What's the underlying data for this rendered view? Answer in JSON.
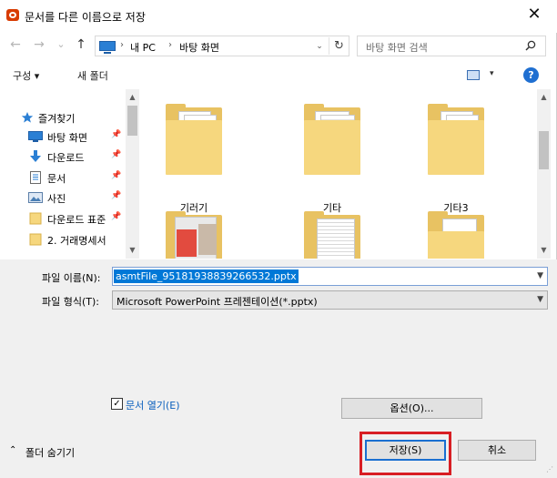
{
  "window": {
    "title": "문서를 다른 이름으로 저장",
    "close": "✕"
  },
  "nav": {
    "back": "←",
    "forward": "→",
    "recent": "⌄",
    "up": "↑",
    "breadcrumb": [
      "내 PC",
      "바탕 화면"
    ],
    "separator": "›",
    "dropdown": "⌄",
    "refresh": "↻",
    "search_placeholder": "바탕 화면 검색"
  },
  "toolbar": {
    "organize": "구성 ▾",
    "new_folder": "새 폴더",
    "view_dd": "▾",
    "help": "?"
  },
  "sidebar": {
    "items": [
      {
        "label": "즐겨찾기",
        "icon": "star-icon",
        "pinned": false
      },
      {
        "label": "바탕 화면",
        "icon": "desktop-icon",
        "pinned": true
      },
      {
        "label": "다운로드",
        "icon": "download-icon",
        "pinned": true
      },
      {
        "label": "문서",
        "icon": "document-icon",
        "pinned": true
      },
      {
        "label": "사진",
        "icon": "picture-icon",
        "pinned": true
      },
      {
        "label": "다운로드 표준",
        "icon": "folder-icon",
        "pinned": true
      },
      {
        "label": "2. 거래명세서",
        "icon": "folder-icon",
        "pinned": false
      }
    ],
    "scroll_up": "▲",
    "scroll_down": "▼"
  },
  "files": [
    {
      "name": "기러기",
      "kind": "word-folder"
    },
    {
      "name": "기타",
      "kind": "doc-folder"
    },
    {
      "name": "기타3",
      "kind": "word-folder"
    },
    {
      "name": "",
      "kind": "image-folder"
    },
    {
      "name": "",
      "kind": "doc-folder"
    },
    {
      "name": "",
      "kind": "plain-folder"
    }
  ],
  "form": {
    "filename_label": "파일 이름(N):",
    "filename_value": "asmtFile_95181938839266532.pptx",
    "filetype_label": "파일 형식(T):",
    "filetype_value": "Microsoft PowerPoint 프레젠테이션(*.pptx)",
    "open_doc_label": "문서 열기(E)",
    "open_doc_checked": true,
    "options_button": "옵션(O)...",
    "save_button": "저장(S)",
    "cancel_button": "취소",
    "hide_folders": "폴더 숨기기"
  },
  "colors": {
    "accent": "#0078d7",
    "highlight_box": "#d81e24",
    "folder": "#e8c262",
    "link_text": "#0a5fbd"
  }
}
